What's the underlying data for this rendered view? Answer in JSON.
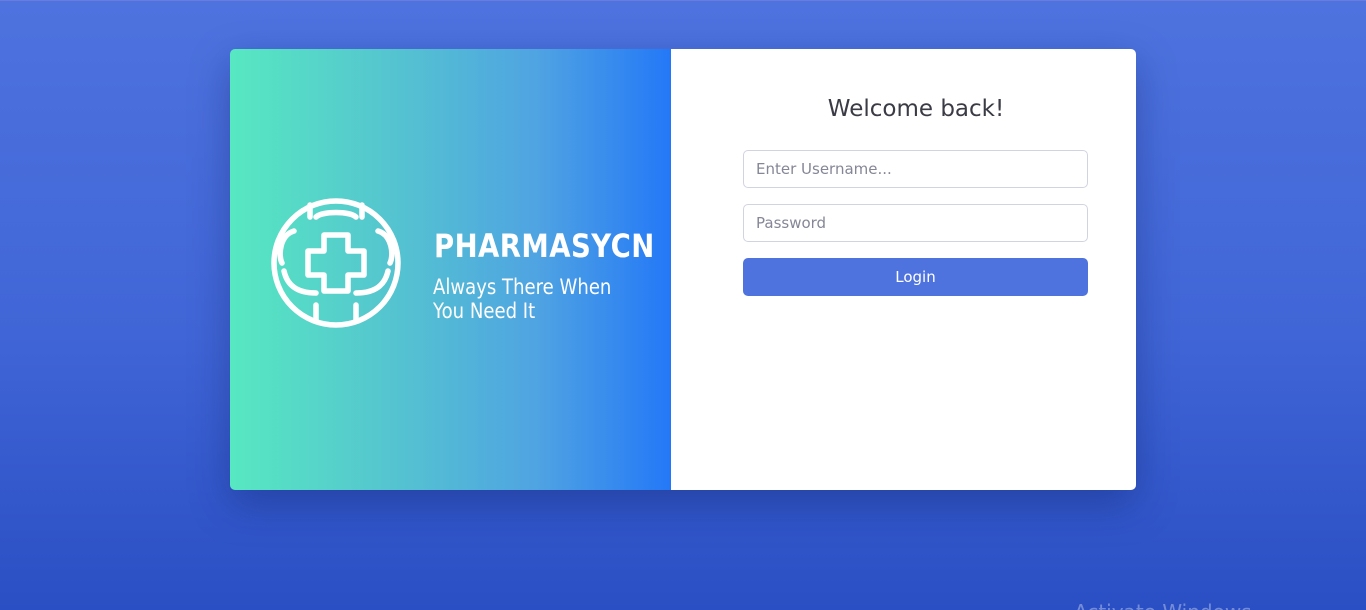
{
  "brand": {
    "logo_icon": "medical-cross-circle-icon",
    "name": "PHARMASYCN",
    "tagline": "Always There When You Need It"
  },
  "login": {
    "heading": "Welcome back!",
    "username_placeholder": "Enter Username...",
    "password_placeholder": "Password",
    "submit_label": "Login"
  },
  "os_watermark": "Activate Windows",
  "colors": {
    "background_top": "#4e73df",
    "background_bottom": "#2a4fc4",
    "brand_gradient_start": "#57e8c1",
    "brand_gradient_end": "#2478f7",
    "button": "#4e73df",
    "heading_text": "#3a3b45"
  }
}
